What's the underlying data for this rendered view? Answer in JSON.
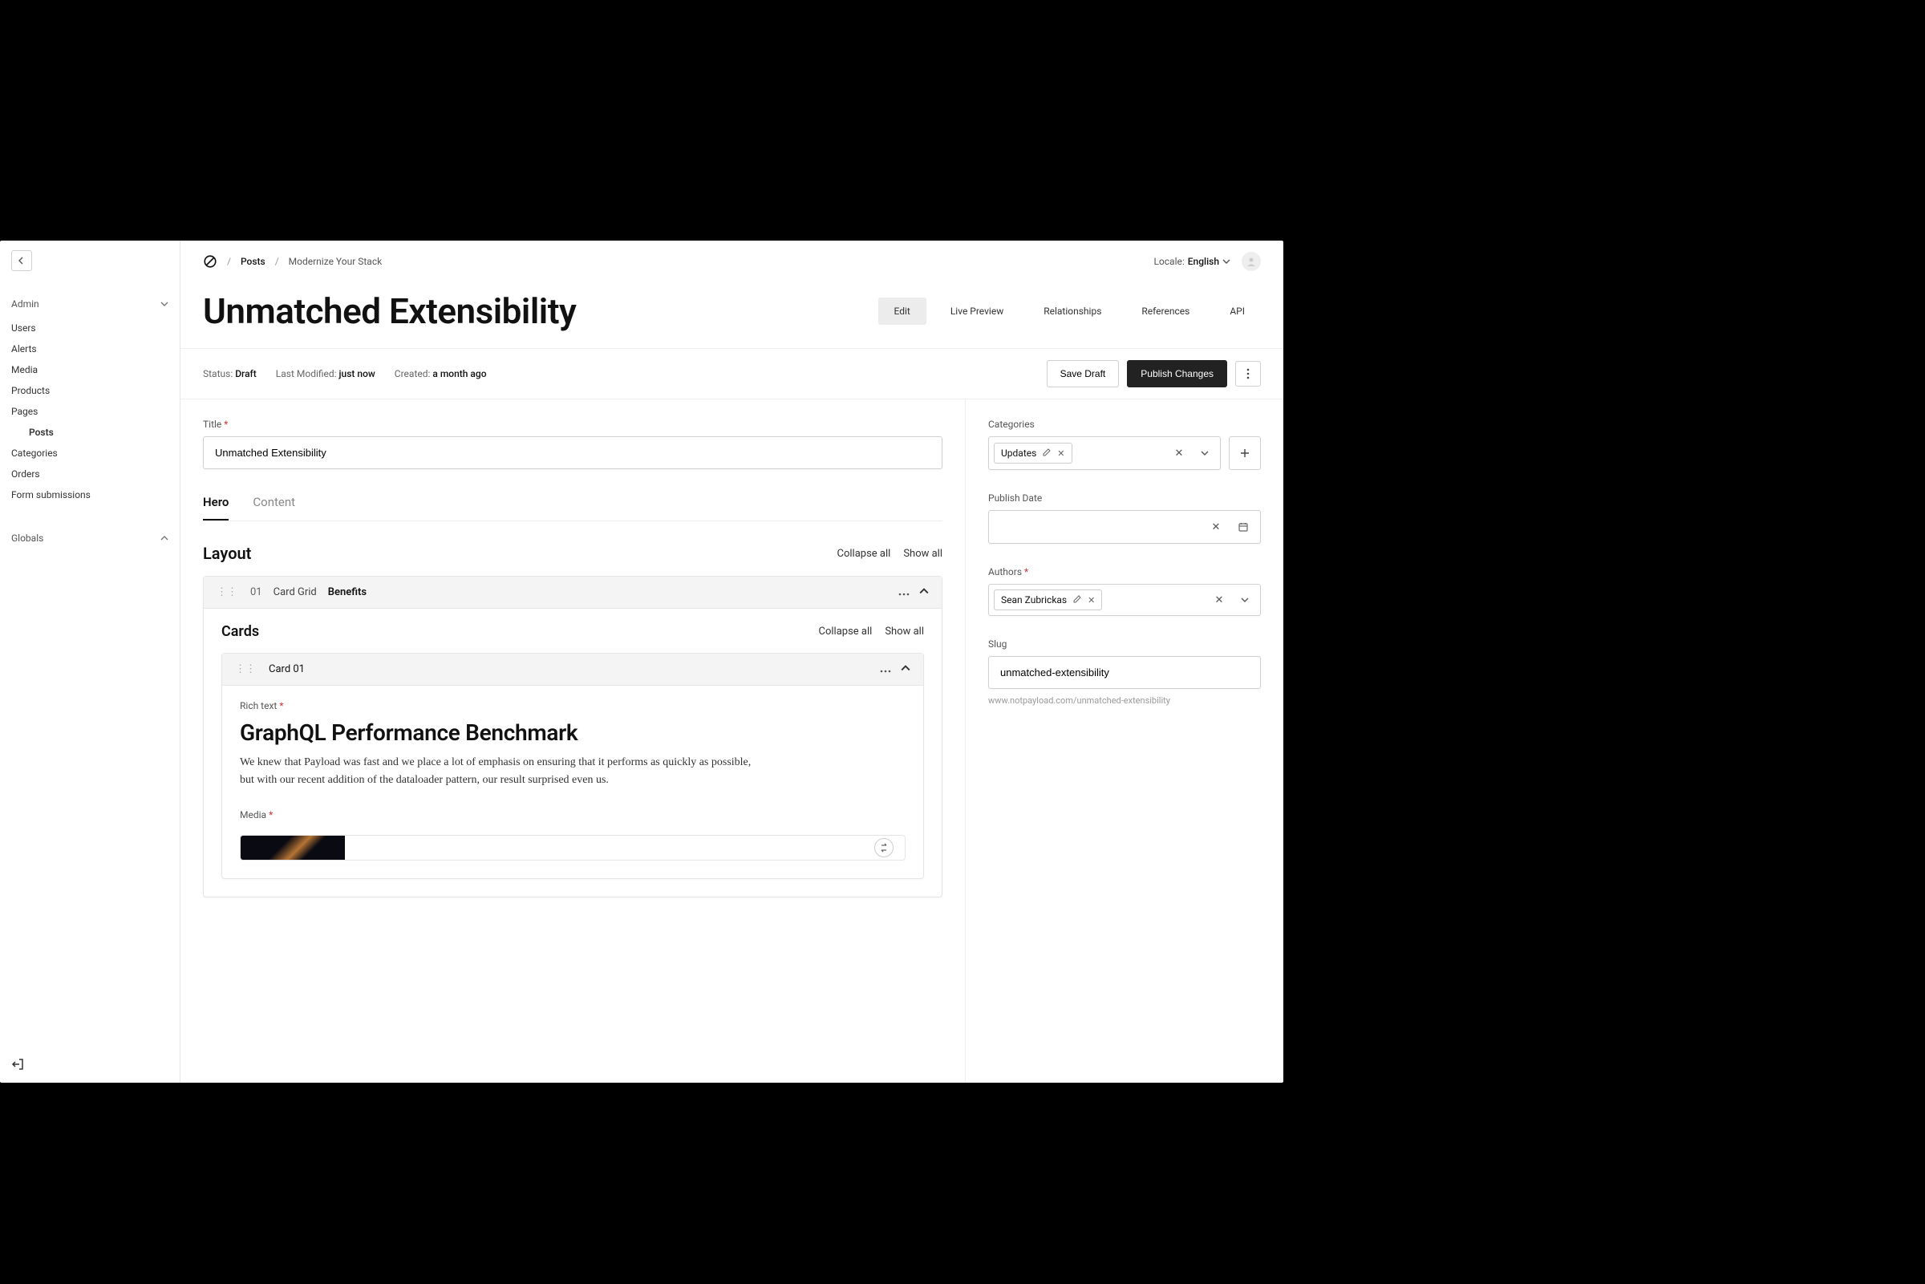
{
  "sidebar": {
    "sections": {
      "admin": {
        "label": "Admin"
      },
      "globals": {
        "label": "Globals"
      }
    },
    "items": [
      {
        "label": "Users"
      },
      {
        "label": "Alerts"
      },
      {
        "label": "Media"
      },
      {
        "label": "Products"
      },
      {
        "label": "Pages"
      },
      {
        "label": "Posts"
      },
      {
        "label": "Categories"
      },
      {
        "label": "Orders"
      },
      {
        "label": "Form submissions"
      }
    ]
  },
  "breadcrumb": {
    "collection": "Posts",
    "current": "Modernize Your Stack"
  },
  "locale": {
    "label": "Locale:",
    "value": "English"
  },
  "page": {
    "title": "Unmatched Extensibility"
  },
  "viewTabs": [
    "Edit",
    "Live Preview",
    "Relationships",
    "References",
    "API"
  ],
  "status": {
    "statusLabel": "Status:",
    "statusValue": "Draft",
    "modifiedLabel": "Last Modified:",
    "modifiedValue": "just now",
    "createdLabel": "Created:",
    "createdValue": "a month ago",
    "saveDraft": "Save Draft",
    "publish": "Publish Changes"
  },
  "fields": {
    "title": {
      "label": "Title",
      "value": "Unmatched Extensibility"
    }
  },
  "subTabs": [
    "Hero",
    "Content"
  ],
  "layout": {
    "heading": "Layout",
    "collapseAll": "Collapse all",
    "showAll": "Show all",
    "block": {
      "index": "01",
      "type": "Card Grid",
      "name": "Benefits"
    }
  },
  "cards": {
    "heading": "Cards",
    "collapseAll": "Collapse all",
    "showAll": "Show all",
    "card": {
      "label": "Card 01",
      "richTextLabel": "Rich text",
      "title": "GraphQL Performance Benchmark",
      "body": "We knew that Payload was fast and we place a lot of emphasis on ensuring that it performs as quickly as possible, but with our recent addition of the dataloader pattern, our result surprised even us.",
      "mediaLabel": "Media"
    }
  },
  "side": {
    "categories": {
      "label": "Categories",
      "chip": "Updates"
    },
    "publishDate": {
      "label": "Publish Date",
      "value": ""
    },
    "authors": {
      "label": "Authors",
      "chip": "Sean Zubrickas"
    },
    "slug": {
      "label": "Slug",
      "value": "unmatched-extensibility",
      "url": "www.notpayload.com/unmatched-extensibility"
    }
  }
}
